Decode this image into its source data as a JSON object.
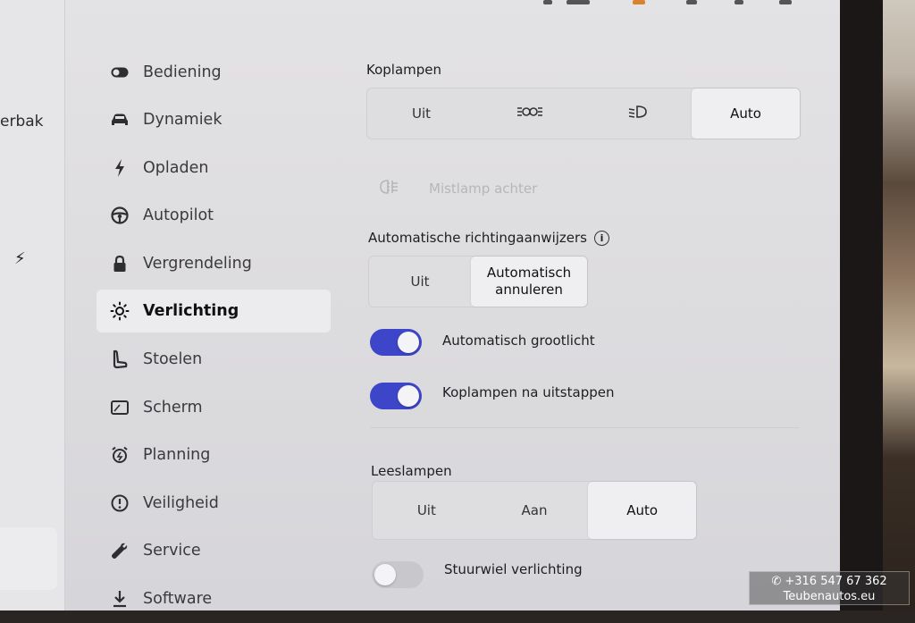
{
  "left_panel": {
    "partial_text": "erbak"
  },
  "nav": {
    "items": [
      {
        "label": "Bediening",
        "icon": "toggle-icon"
      },
      {
        "label": "Dynamiek",
        "icon": "car-icon"
      },
      {
        "label": "Opladen",
        "icon": "bolt-icon"
      },
      {
        "label": "Autopilot",
        "icon": "steering-wheel-icon"
      },
      {
        "label": "Vergrendeling",
        "icon": "lock-icon"
      },
      {
        "label": "Verlichting",
        "icon": "light-bulb-icon",
        "active": true
      },
      {
        "label": "Stoelen",
        "icon": "seat-icon"
      },
      {
        "label": "Scherm",
        "icon": "screen-icon"
      },
      {
        "label": "Planning",
        "icon": "alarm-clock-icon"
      },
      {
        "label": "Veiligheid",
        "icon": "alert-circle-icon"
      },
      {
        "label": "Service",
        "icon": "wrench-icon"
      },
      {
        "label": "Software",
        "icon": "download-icon"
      }
    ]
  },
  "koplampen": {
    "title": "Koplampen",
    "options": [
      "Uit",
      "",
      "",
      "Auto"
    ],
    "selected": "Auto"
  },
  "mistlamp": {
    "label": "Mistlamp achter"
  },
  "richting": {
    "title": "Automatische richtingaanwijzers",
    "options": [
      "Uit",
      "Automatisch annuleren"
    ],
    "selected": "Automatisch annuleren"
  },
  "toggles": [
    {
      "label": "Automatisch grootlicht",
      "on": true
    },
    {
      "label": "Koplampen na uitstappen",
      "on": true
    }
  ],
  "leeslampen": {
    "title": "Leeslampen",
    "options": [
      "Uit",
      "Aan",
      "Auto"
    ],
    "selected": "Auto"
  },
  "stuurwiel": {
    "label": "Stuurwiel verlichting",
    "on": false
  },
  "watermark": {
    "phone": "+316 547 67 362",
    "site": "Teubenautos.eu"
  },
  "colors": {
    "toggle_on": "#3d45c8",
    "background": "#e0dfe2"
  }
}
